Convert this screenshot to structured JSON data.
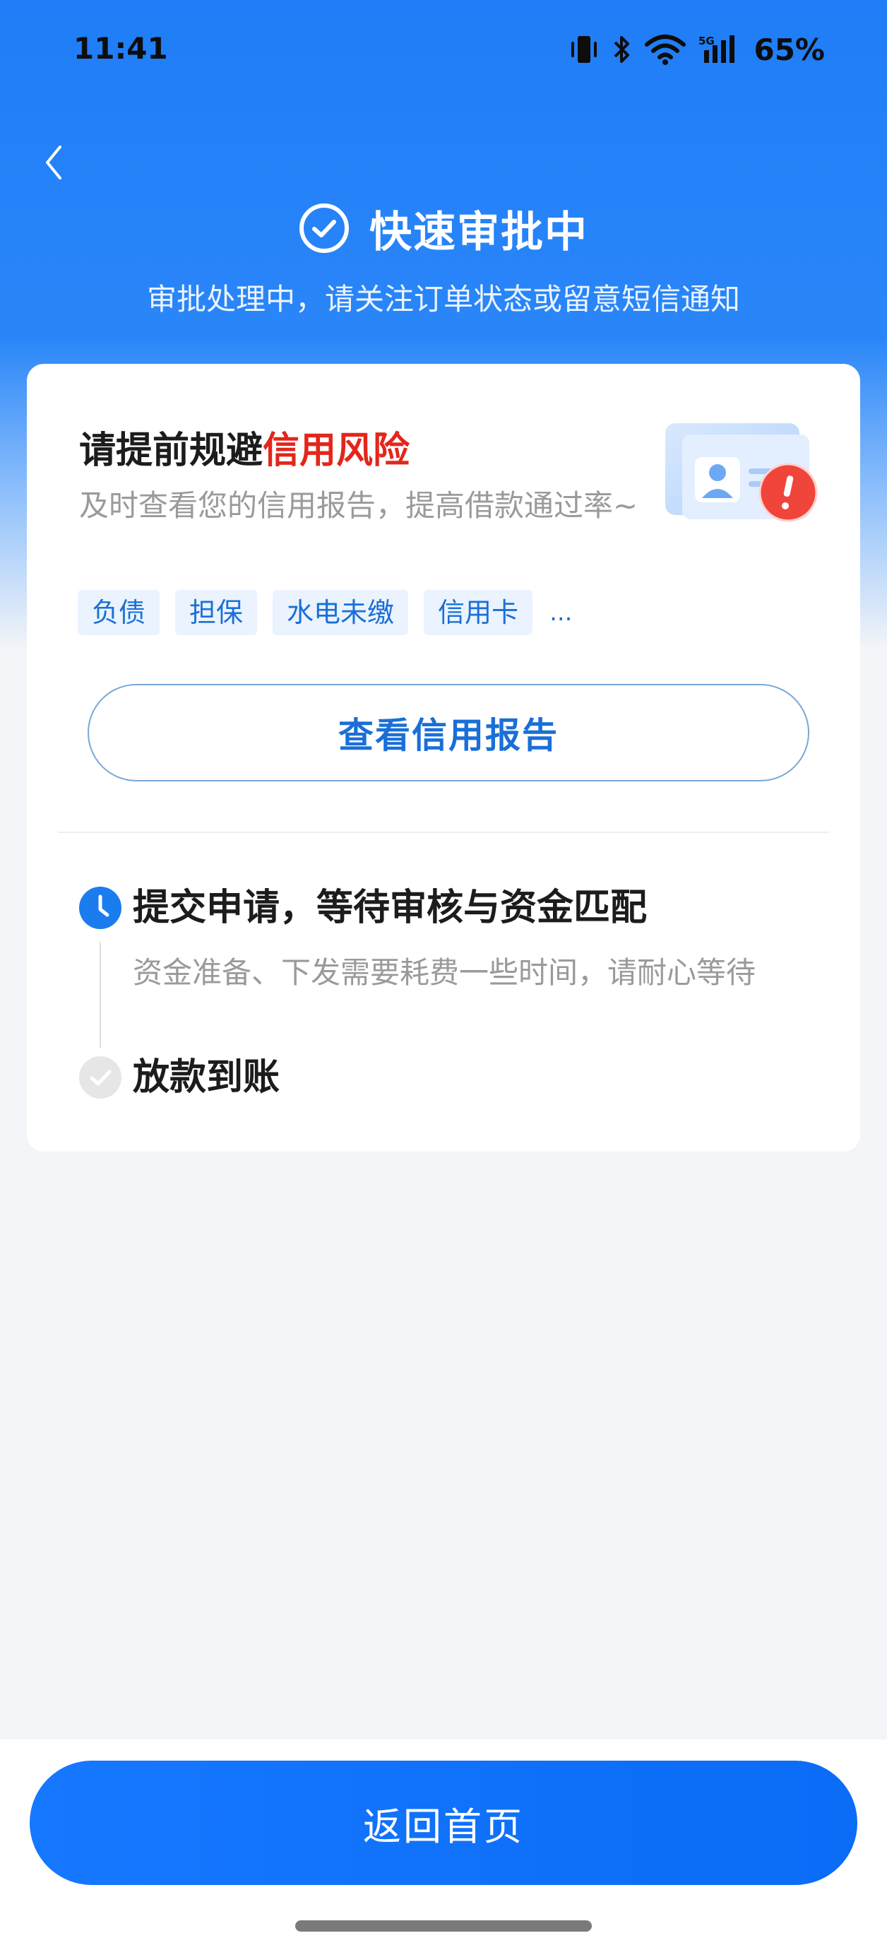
{
  "status_bar": {
    "time": "11:41",
    "battery": "65%",
    "network": "5G",
    "icons": [
      "vibrate-icon",
      "bluetooth-icon",
      "wifi-icon",
      "signal-icon"
    ]
  },
  "header": {
    "back_icon": "chevron-left-icon",
    "title": "快速审批中",
    "subtitle": "审批处理中，请关注订单状态或留意短信通知"
  },
  "credit_card": {
    "title_prefix": "请提前规避",
    "title_highlight": "信用风险",
    "description": "及时查看您的信用报告，提高借款通过率~",
    "tags": [
      "负债",
      "担保",
      "水电未缴",
      "信用卡"
    ],
    "more": "...",
    "button_label": "查看信用报告"
  },
  "steps": [
    {
      "title": "提交申请，等待审核与资金匹配",
      "desc": "资金准备、下发需要耗费一些时间，请耐心等待",
      "status": "in-progress"
    },
    {
      "title": "放款到账",
      "status": "pending"
    }
  ],
  "footer": {
    "home_button_label": "返回首页"
  },
  "colors": {
    "primary": "#1677ff",
    "risk_red": "#e3261b",
    "tag_bg": "#eaf3fe",
    "page_bg": "#f4f5f8"
  }
}
